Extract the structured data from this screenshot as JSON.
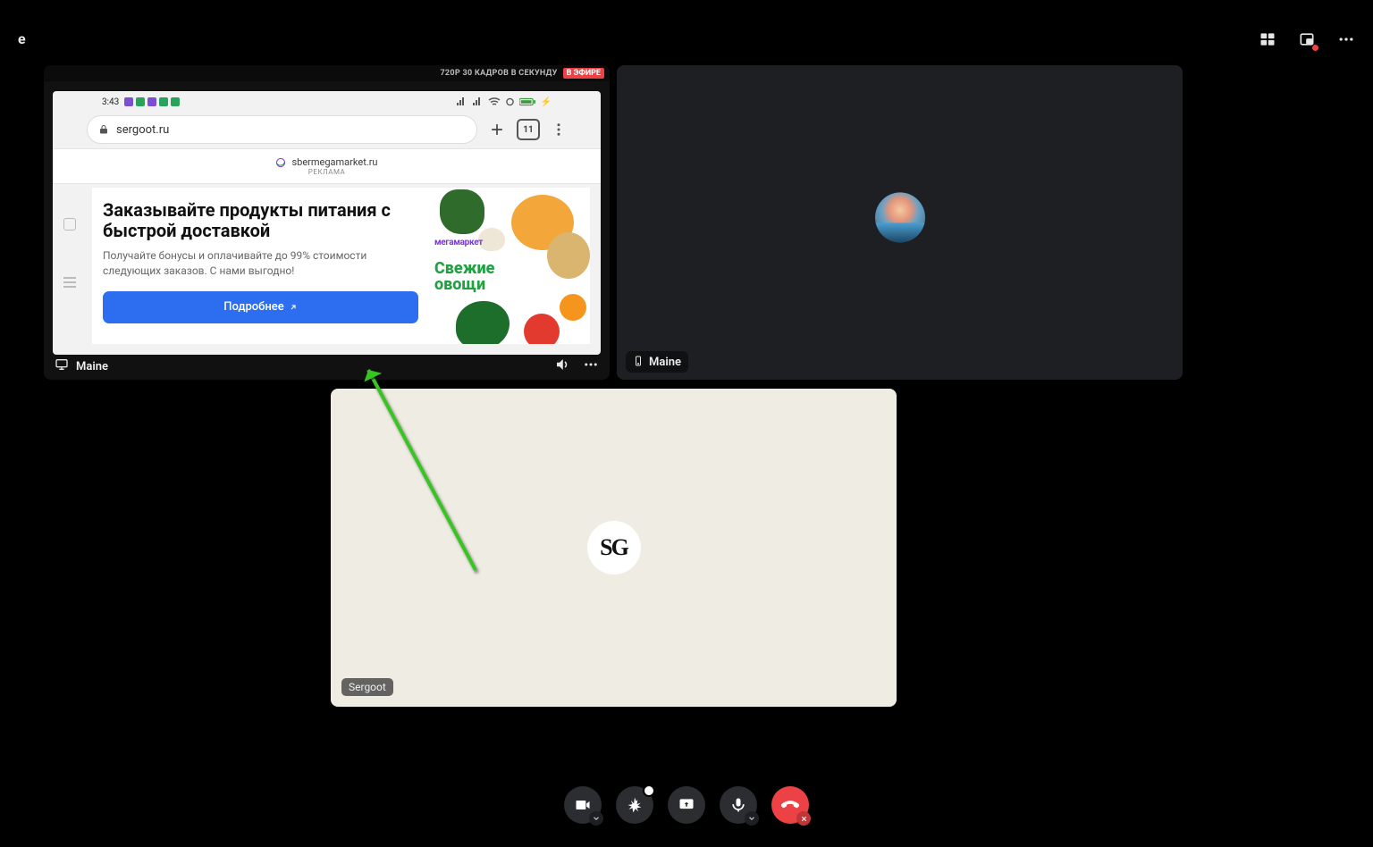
{
  "topbar": {
    "channel_letter": "е"
  },
  "tile1": {
    "quality": "720P 30 КАДРОВ В СЕКУНДУ",
    "live": "В ЭФИРЕ",
    "phone": {
      "time": "3:43",
      "url": "sergoot.ru",
      "tab_count": "11",
      "ad_domain": "sbermegamarket.ru",
      "ad_label": "РЕКЛАМА",
      "headline": "Заказывайте продукты питания с быстрой доставкой",
      "sub": "Получайте бонусы и оплачивайте до 99% стоимости следующих заказов. С нами выгодно!",
      "cta": "Подробнее",
      "mm_logo": "мегамаркет",
      "fresh1": "Свежие",
      "fresh2": "овощи"
    },
    "name": "Maine"
  },
  "tile2": {
    "name": "Maine"
  },
  "tile3": {
    "name": "Sergoot",
    "avatar_text": "SG"
  }
}
